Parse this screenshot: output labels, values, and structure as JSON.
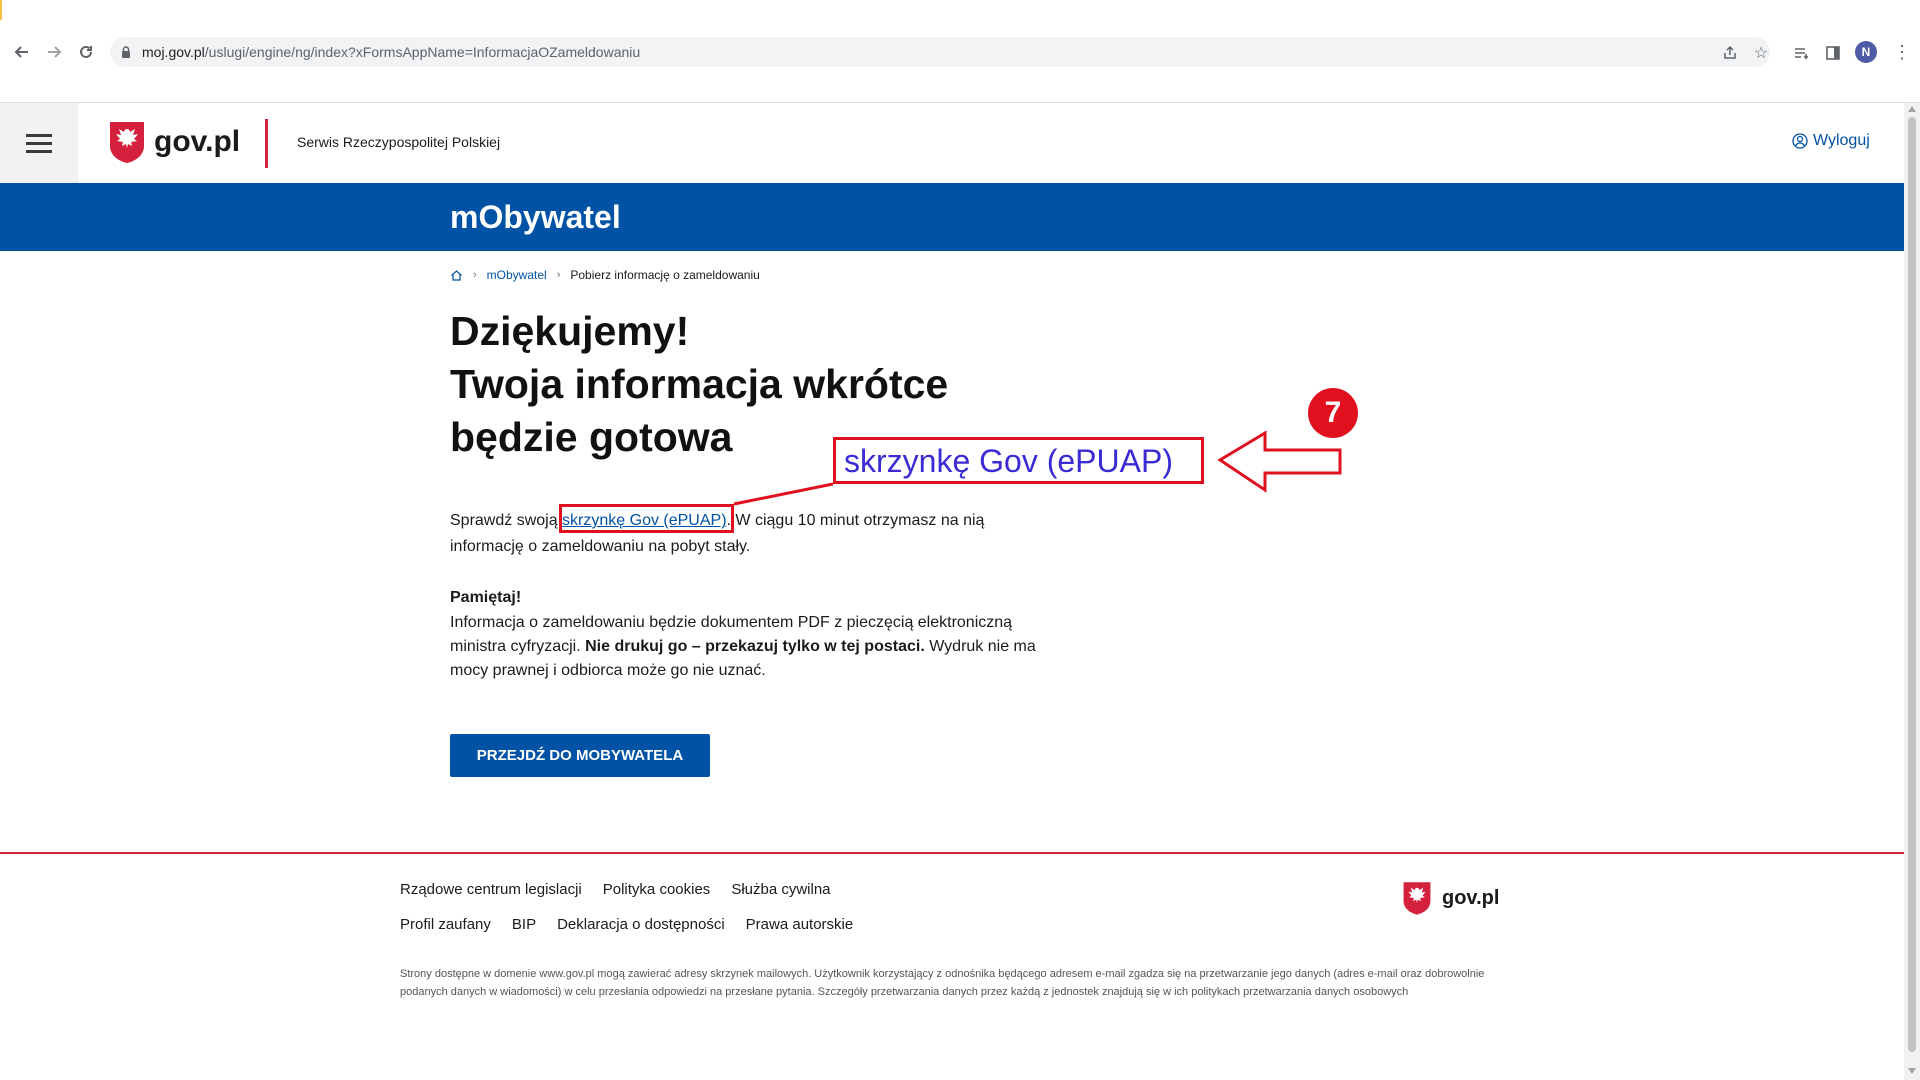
{
  "browser": {
    "url_domain": "moj.gov.pl",
    "url_path": "/uslugi/engine/ng/index?xFormsAppName=InformacjaOZameldowaniu",
    "profile_initial": "N"
  },
  "header": {
    "brand": "gov.pl",
    "service_name": "Serwis Rzeczypospolitej Polskiej",
    "logout_label": "Wyloguj"
  },
  "banner": {
    "title": "mObywatel"
  },
  "breadcrumb": {
    "home_icon": "home-icon",
    "items": [
      "mObywatel",
      "Pobierz informację o zameldowaniu"
    ]
  },
  "main": {
    "heading_line1": "Dziękujemy!",
    "heading_line2": "Twoja informacja wkrótce",
    "heading_line3": "będzie gotowa",
    "para_before": "Sprawdź swoją ",
    "para_link": "skrzynkę Gov (ePUAP)",
    "para_after": ". W ciągu 10 minut otrzymasz na nią informację o zameldowaniu na pobyt stały.",
    "remember_title": "Pamiętaj!",
    "remember_text1": "Informacja o zameldowaniu będzie dokumentem PDF z pieczęcią elektroniczną ministra cyfryzacji. ",
    "remember_bold": "Nie drukuj go – przekazuj tylko w tej postaci.",
    "remember_text2": " Wydruk nie ma mocy prawnej i odbiorca może go nie uznać.",
    "cta_label": "PRZEJDŹ DO MOBYWATELA"
  },
  "annotation": {
    "step_number": "7",
    "callout_text": "skrzynkę Gov (ePUAP)",
    "color": "#e0101f"
  },
  "footer": {
    "links_row1": [
      "Rządowe centrum legislacji",
      "Polityka cookies",
      "Służba cywilna"
    ],
    "links_row2": [
      "Profil zaufany",
      "BIP",
      "Deklaracja o dostępności",
      "Prawa autorskie"
    ],
    "brand": "gov.pl",
    "disclaimer": "Strony dostępne w domenie www.gov.pl mogą zawierać adresy skrzynek mailowych. Użytkownik korzystający z odnośnika będącego adresem e-mail zgadza się na przetwarzanie jego danych (adres e-mail oraz dobrowolnie podanych danych w wiadomości) w celu przesłania odpowiedzi na przesłane pytania. Szczegóły przetwarzania danych przez każdą z jednostek znajdują się w ich politykach przetwarzania danych osobowych"
  },
  "colors": {
    "primary_blue": "#0052a5",
    "gov_red": "#d4213d"
  }
}
